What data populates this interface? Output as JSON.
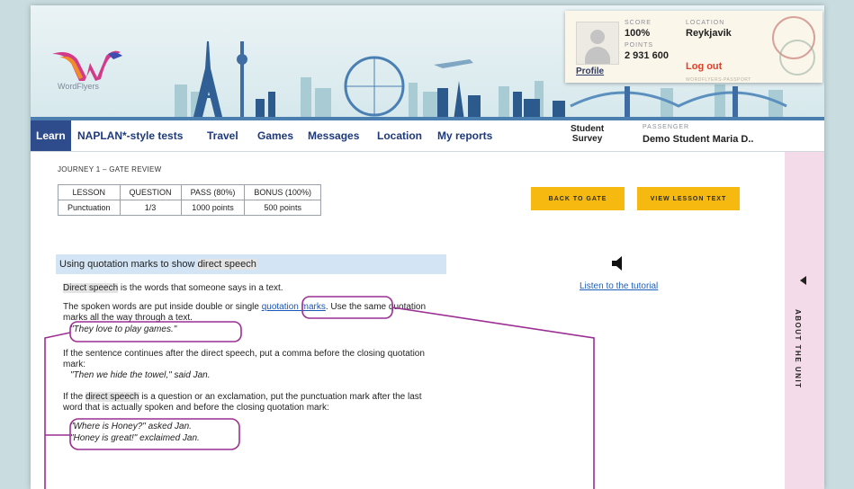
{
  "brand": {
    "name": "WordFlyers"
  },
  "colors": {
    "accent": "#f5b90f",
    "nav": "#1e3a7b",
    "annotation": "#9c2f93"
  },
  "user_card": {
    "score_label": "SCORE",
    "score_value": "100%",
    "points_label": "POINTS",
    "points_value": "2 931 600",
    "location_label": "LOCATION",
    "location_value": "Reykjavik",
    "profile_link": "Profile",
    "logout_link": "Log out",
    "fine_print": "WORDFLYERS-PASSPORT"
  },
  "nav": {
    "tabs": [
      {
        "label": "Learn"
      },
      {
        "label": "NAPLAN*-style tests"
      },
      {
        "label": "Travel"
      },
      {
        "label": "Games"
      },
      {
        "label": "Messages"
      },
      {
        "label": "Location"
      },
      {
        "label": "My reports"
      }
    ],
    "survey_line1": "Student",
    "survey_line2": "Survey",
    "passenger_label": "PASSENGER",
    "passenger_name": "Demo Student Maria D.."
  },
  "side_panel": {
    "label": "ABOUT THE UNIT"
  },
  "lesson": {
    "breadcrumb": "JOURNEY 1 – GATE REVIEW",
    "table": {
      "headers": [
        "LESSON",
        "QUESTION",
        "PASS (80%)",
        "BONUS (100%)"
      ],
      "row": [
        "Punctuation",
        "1/3",
        "1000 points",
        "500 points"
      ]
    },
    "back_button": "BACK TO GATE",
    "view_button": "VIEW LESSON TEXT",
    "heading_pre": "Using quotation marks to show ",
    "heading_hl": "direct speech",
    "listen": "Listen to the tutorial",
    "p1_hl": "Direct speech",
    "p1_rest": " is the words that someone says in a text.",
    "p2_a": "The spoken words are put inside double or single ",
    "p2_link": "quotation marks",
    "p2_b": ". Use the same quotation",
    "p2_c": "marks all the way through a text.",
    "q1": "\"They love to play games.\"",
    "p3_a": "If the sentence continues after the direct speech, put a comma before the closing quotation",
    "p3_b": "mark:",
    "q2": "\"Then we hide the towel,\" said Jan.",
    "p4_pre": "If the ",
    "p4_hl": "direct speech",
    "p4_a": " is a question or an exclamation, put the punctuation mark after the last",
    "p4_b": "word that is actually spoken and before the closing quotation mark:",
    "q3": "\"Where is Honey?\" asked Jan.",
    "q4": "\"Honey is great!\" exclaimed Jan."
  }
}
